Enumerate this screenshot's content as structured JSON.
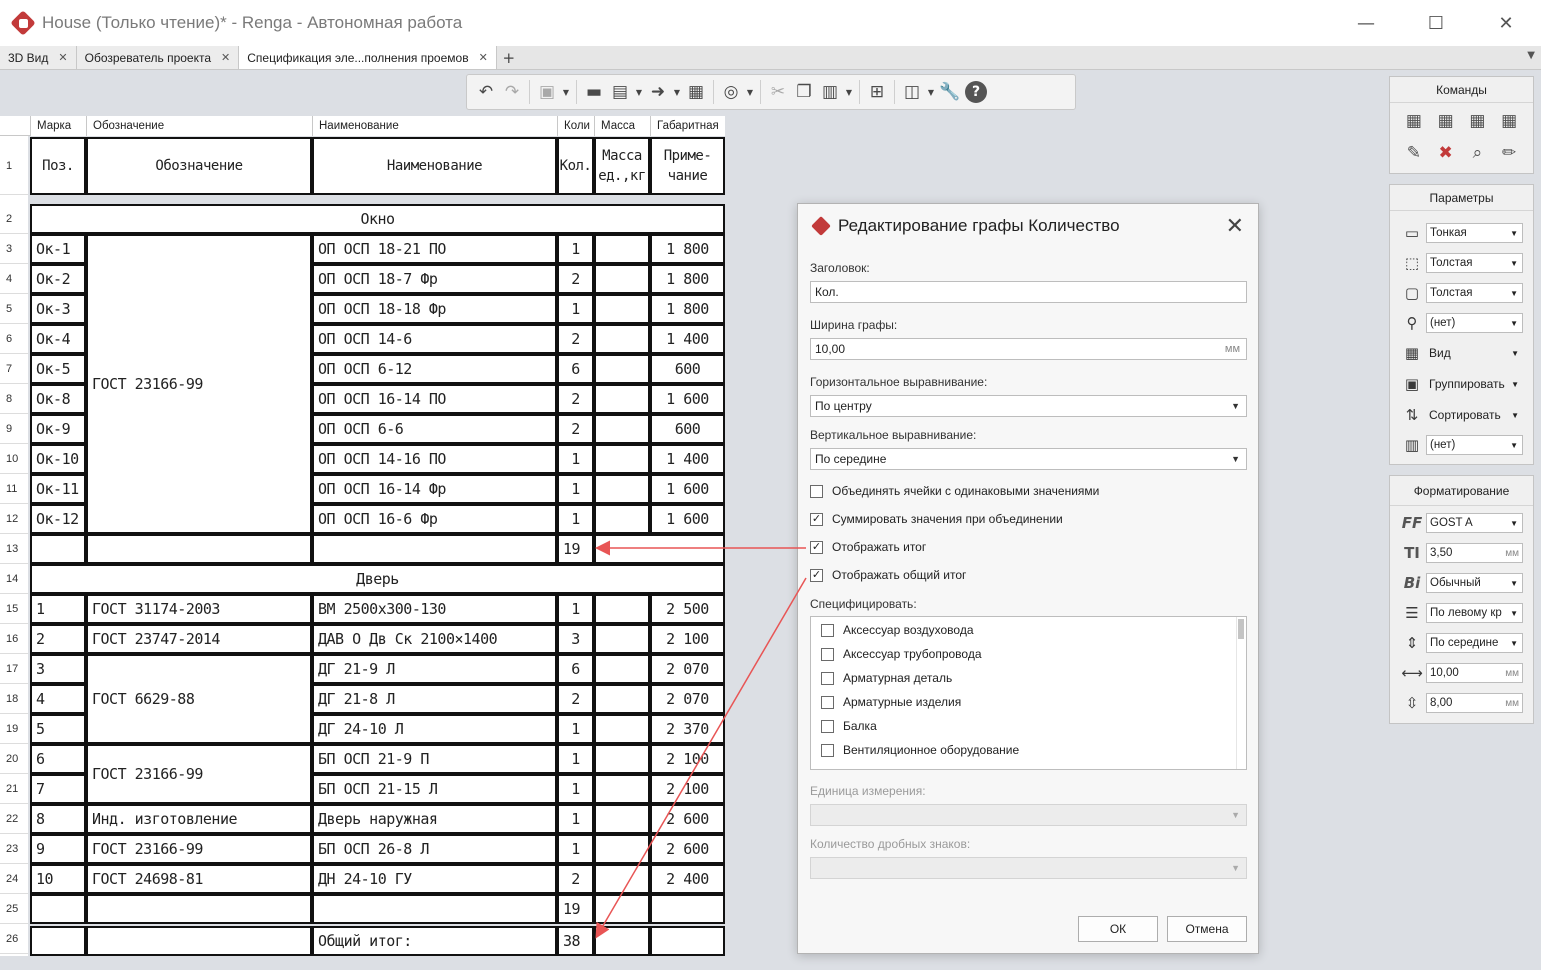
{
  "window": {
    "title": "House (Только чтение)* - Renga - Автономная работа",
    "min_glyph": "—",
    "max_glyph": "☐",
    "close_glyph": "✕"
  },
  "tabs": [
    {
      "label": "3D Вид"
    },
    {
      "label": "Обозреватель проекта"
    },
    {
      "label": "Спецификация эле...полнения проемов"
    }
  ],
  "tab_add_glyph": "+",
  "spec": {
    "column_headers": [
      "Марка",
      "Обозначение",
      "Наименование",
      "Коли",
      "Масса",
      "Габаритная"
    ],
    "header_row": {
      "num": "1",
      "cells": [
        "Поз.",
        "Обозначение",
        "Наименование",
        "Кол.",
        "Масса\nед.,кг",
        "Приме-\nчание"
      ]
    },
    "group_window": {
      "num": "2",
      "label": "Окно"
    },
    "window_rows": [
      {
        "num": "3",
        "mark": "Ок-1",
        "name": "ОП ОСП 18-21 ПО",
        "qty": "1",
        "note": "1 800"
      },
      {
        "num": "4",
        "mark": "Ок-2",
        "name": "ОП ОСП 18-7 Фр",
        "qty": "2",
        "note": "1 800"
      },
      {
        "num": "5",
        "mark": "Ок-3",
        "name": "ОП ОСП 18-18 Фр",
        "qty": "1",
        "note": "1 800"
      },
      {
        "num": "6",
        "mark": "Ок-4",
        "name": "ОП ОСП 14-6",
        "qty": "2",
        "note": "1 400"
      },
      {
        "num": "7",
        "mark": "Ок-5",
        "name": "ОП ОСП 6-12",
        "qty": "6",
        "note": "600"
      },
      {
        "num": "8",
        "mark": "Ок-8",
        "name": "ОП ОСП 16-14 ПО",
        "qty": "2",
        "note": "1 600"
      },
      {
        "num": "9",
        "mark": "Ок-9",
        "name": "ОП ОСП 6-6",
        "qty": "2",
        "note": "600"
      },
      {
        "num": "10",
        "mark": "Ок-10",
        "name": "ОП ОСП 14-16 ПО",
        "qty": "1",
        "note": "1 400"
      },
      {
        "num": "11",
        "mark": "Ок-11",
        "name": "ОП ОСП 16-14 Фр",
        "qty": "1",
        "note": "1 600"
      },
      {
        "num": "12",
        "mark": "Ок-12",
        "name": "ОП ОСП 16-6 Фр",
        "qty": "1",
        "note": "1 600"
      }
    ],
    "window_designation": "ГОСТ 23166-99",
    "window_total": {
      "num": "13",
      "qty": "19"
    },
    "group_door": {
      "num": "14",
      "label": "Дверь"
    },
    "door_rows": [
      {
        "num": "15",
        "mark": "1",
        "name": "ВМ 2500х300-130",
        "qty": "1",
        "note": "2 500"
      },
      {
        "num": "16",
        "mark": "2",
        "name": "ДАВ О Дв Ск 2100×1400",
        "qty": "3",
        "note": "2 100"
      },
      {
        "num": "17",
        "mark": "3",
        "name": "ДГ 21-9 Л",
        "qty": "6",
        "note": "2 070"
      },
      {
        "num": "18",
        "mark": "4",
        "name": "ДГ 21-8 Л",
        "qty": "2",
        "note": "2 070"
      },
      {
        "num": "19",
        "mark": "5",
        "name": "ДГ 24-10 Л",
        "qty": "1",
        "note": "2 370"
      },
      {
        "num": "20",
        "mark": "6",
        "name": "БП ОСП 21-9 П",
        "qty": "1",
        "note": "2 100"
      },
      {
        "num": "21",
        "mark": "7",
        "name": "БП ОСП 21-15 Л",
        "qty": "1",
        "note": "2 100"
      },
      {
        "num": "22",
        "mark": "8",
        "name": "Дверь наружная",
        "qty": "1",
        "note": "2 600"
      },
      {
        "num": "23",
        "mark": "9",
        "name": "БП ОСП 26-8 Л",
        "qty": "1",
        "note": "2 600"
      },
      {
        "num": "24",
        "mark": "10",
        "name": "ДН 24-10 ГУ",
        "qty": "2",
        "note": "2 400"
      }
    ],
    "door_designations": {
      "r15": "ГОСТ 31174-2003",
      "r16": "ГОСТ 23747-2014",
      "r17_19": "ГОСТ 6629-88",
      "r20_21": "ГОСТ 23166-99",
      "r22": "Инд. изготовление",
      "r23": "ГОСТ 23166-99",
      "r24": "ГОСТ 24698-81"
    },
    "door_total": {
      "num": "25",
      "qty": "19"
    },
    "grand_total": {
      "num": "26",
      "label": "Общий итог:",
      "qty": "38"
    }
  },
  "dialog": {
    "title": "Редактирование графы Количество",
    "close_glyph": "✕",
    "header_label": "Заголовок:",
    "header_value": "Кол.",
    "width_label": "Ширина графы:",
    "width_value": "10,00",
    "width_unit": "мм",
    "halign_label": "Горизонтальное выравнивание:",
    "halign_value": "По центру",
    "valign_label": "Вертикальное выравнивание:",
    "valign_value": "По середине",
    "checkboxes": [
      {
        "label": "Объединять ячейки с одинаковыми значениями",
        "mark": ""
      },
      {
        "label": "Суммировать значения при объединении",
        "mark": "✓"
      },
      {
        "label": "Отображать итог",
        "mark": "✓"
      },
      {
        "label": "Отображать общий итог",
        "mark": "✓"
      }
    ],
    "specify_label": "Специфицировать:",
    "specify_items": [
      "Аксессуар воздуховода",
      "Аксессуар трубопровода",
      "Арматурная деталь",
      "Арматурные изделия",
      "Балка",
      "Вентиляционное оборудование"
    ],
    "unit_label": "Единица измерения:",
    "decimals_label": "Количество дробных знаков:",
    "ok_label": "ОК",
    "cancel_label": "Отмена",
    "dropdown_glyph": "▼"
  },
  "panels": {
    "commands_title": "Команды",
    "params_title": "Параметры",
    "params": [
      {
        "value": "Тонкая",
        "kind": "select"
      },
      {
        "value": "Толстая",
        "kind": "select"
      },
      {
        "value": "Толстая",
        "kind": "select"
      },
      {
        "value": "(нет)",
        "kind": "select"
      },
      {
        "value": "Вид",
        "kind": "menu"
      },
      {
        "value": "Группировать",
        "kind": "menu"
      },
      {
        "value": "Сортировать",
        "kind": "menu"
      },
      {
        "value": "(нет)",
        "kind": "select"
      }
    ],
    "format_title": "Форматирование",
    "format": [
      {
        "icon_text": "FF",
        "value": "GOST A",
        "kind": "select"
      },
      {
        "icon_text": "TI",
        "value": "3,50",
        "unit": "мм",
        "kind": "num"
      },
      {
        "icon_text": "Bi",
        "value": "Обычный",
        "kind": "select"
      },
      {
        "icon_text": "",
        "value": "По левому кр",
        "kind": "select"
      },
      {
        "icon_text": "",
        "value": "По середине",
        "kind": "select"
      },
      {
        "icon_text": "",
        "value": "10,00",
        "unit": "мм",
        "kind": "num"
      },
      {
        "icon_text": "",
        "value": "8,00",
        "unit": "мм",
        "kind": "num"
      }
    ]
  },
  "colors": {
    "accent": "#c23a3a",
    "arrow": "#e85555"
  }
}
